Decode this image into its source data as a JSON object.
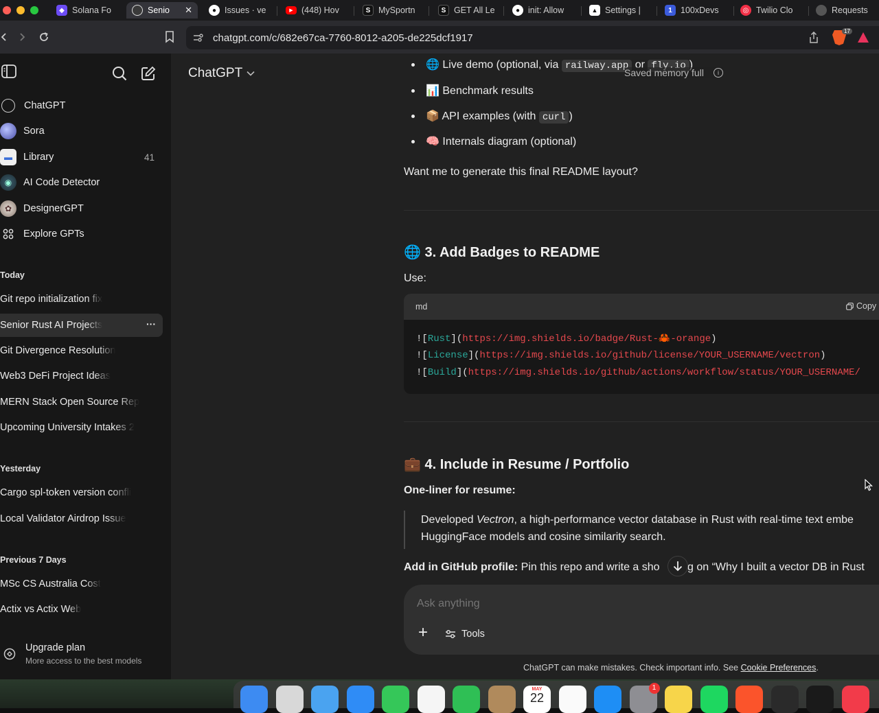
{
  "browser": {
    "tabs": [
      {
        "label": "Solana Fo",
        "icon": "solana-icon",
        "color": "#6c4cf5"
      },
      {
        "label": "Senio",
        "icon": "chatgpt-icon",
        "color": "#ffffff",
        "active": true,
        "close": "✕"
      },
      {
        "label": "Issues · ve",
        "icon": "github-icon",
        "color": "#ffffff"
      },
      {
        "label": "(448) Hov",
        "icon": "youtube-icon",
        "color": "#ff0000"
      },
      {
        "label": "MySportn",
        "icon": "s-icon",
        "color": "#111111"
      },
      {
        "label": "GET All Le",
        "icon": "s-icon",
        "color": "#111111"
      },
      {
        "label": "init: Allow",
        "icon": "github-icon",
        "color": "#ffffff"
      },
      {
        "label": "Settings |",
        "icon": "vercel-icon",
        "color": "#ffffff"
      },
      {
        "label": "100xDevs",
        "icon": "100xdevs-icon",
        "color": "#3b5bdb"
      },
      {
        "label": "Twilio Clo",
        "icon": "twilio-icon",
        "color": "#f22f46"
      },
      {
        "label": "Requests",
        "icon": "requests-icon",
        "color": "#555555"
      }
    ],
    "url": "chatgpt.com/c/682e67ca-7760-8012-a205-de225dcf1917",
    "shield_count": "17"
  },
  "sidebar": {
    "app_items": [
      {
        "label": "ChatGPT",
        "icon": "chatgpt-logo-icon"
      },
      {
        "label": "Sora",
        "icon": "sora-icon"
      },
      {
        "label": "Library",
        "icon": "library-icon",
        "count": "41"
      },
      {
        "label": "AI Code Detector",
        "icon": "gpt-avatar-icon"
      },
      {
        "label": "DesignerGPT",
        "icon": "gpt-avatar-icon"
      },
      {
        "label": "Explore GPTs",
        "icon": "grid-icon"
      }
    ],
    "sections": [
      {
        "title": "Today",
        "items": [
          "Git repo initialization fix",
          "Senior Rust AI Projects",
          "Git Divergence Resolution",
          "Web3 DeFi Project Ideas",
          "MERN Stack Open Source Rep",
          "Upcoming University Intakes 2"
        ]
      },
      {
        "title": "Yesterday",
        "items": [
          "Cargo spl-token version confli",
          "Local Validator Airdrop Issue"
        ]
      },
      {
        "title": "Previous 7 Days",
        "items": [
          "MSc CS Australia Cost",
          "Actix vs Actix Web"
        ]
      }
    ],
    "active_item": "Senior Rust AI Projects",
    "more_glyph": "···",
    "upgrade": {
      "title": "Upgrade plan",
      "subtitle": "More access to the best models"
    }
  },
  "header": {
    "model": "ChatGPT",
    "memory_notice": "Saved memory full"
  },
  "content": {
    "bullets": {
      "b1": {
        "emoji": "🌐",
        "pre": "Live demo (optional, via",
        "code1": "railway.app",
        "mid": "or",
        "code2": "fly.io",
        "post": ")"
      },
      "b2": {
        "emoji": "📊",
        "text": "Benchmark results"
      },
      "b3": {
        "emoji": "📦",
        "pre": "API examples (with",
        "code": "curl",
        "post": ")"
      },
      "b4": {
        "emoji": "🧠",
        "text": "Internals diagram (optional)"
      }
    },
    "question": "Want me to generate this final README layout?",
    "section3": {
      "emoji": "🌐",
      "title": "3. Add Badges to README",
      "use": "Use:"
    },
    "code": {
      "lang": "md",
      "copy": "Copy",
      "lines": [
        {
          "bang": "![",
          "label": "Rust",
          "mid": "](",
          "url": "https://img.shields.io/badge/Rust-🦀-orange",
          "end": ")"
        },
        {
          "bang": "![",
          "label": "License",
          "mid": "](",
          "url": "https://img.shields.io/github/license/YOUR_USERNAME/vectron",
          "end": ")"
        },
        {
          "bang": "![",
          "label": "Build",
          "mid": "](",
          "url": "https://img.shields.io/github/actions/workflow/status/YOUR_USERNAME/",
          "end": ""
        }
      ]
    },
    "section4": {
      "emoji": "💼",
      "title": "4. Include in Resume / Portfolio"
    },
    "oneliner_label": "One-liner for resume:",
    "quote": {
      "pre": "Developed ",
      "em": "Vectron",
      "post": ", a high-performance vector database in Rust with real-time text embe",
      "line2": "HuggingFace models and cosine similarity search."
    },
    "github": {
      "label": "Add in GitHub profile:",
      "text": "Pin this repo and write a sho",
      "text2": "log on “Why I built a vector DB in Rust"
    }
  },
  "composer": {
    "placeholder": "Ask anything",
    "plus": "+",
    "tools": "Tools"
  },
  "footer": {
    "text": "ChatGPT can make mistakes. Check important info. See ",
    "link": "Cookie Preferences",
    "end": "."
  },
  "dock": {
    "icons": [
      {
        "name": "finder-icon",
        "color": "#3d8bf2"
      },
      {
        "name": "launchpad-icon",
        "color": "#d8d8d8"
      },
      {
        "name": "maps-icon",
        "color": "#4aa3f0"
      },
      {
        "name": "safari-icon",
        "color": "#2f8cf6"
      },
      {
        "name": "messages-icon",
        "color": "#35c759"
      },
      {
        "name": "photos-icon",
        "color": "#f5f5f5"
      },
      {
        "name": "facetime-icon",
        "color": "#2fbf55"
      },
      {
        "name": "contacts-icon",
        "color": "#b08a5c"
      },
      {
        "name": "calendar-icon",
        "color": "#ffffff",
        "month": "MAY",
        "day": "22"
      },
      {
        "name": "reminders-icon",
        "color": "#fafafa"
      },
      {
        "name": "app-store-icon",
        "color": "#1e8ef5"
      },
      {
        "name": "system-settings-icon",
        "color": "#8e8e93",
        "badge": "1"
      },
      {
        "name": "notes-icon",
        "color": "#f7d54a"
      },
      {
        "name": "spotify-icon",
        "color": "#1ed760"
      },
      {
        "name": "brave-icon",
        "color": "#fb542b"
      },
      {
        "name": "vercel-app-icon",
        "color": "#2a2a2a"
      },
      {
        "name": "terminal-icon",
        "color": "#1a1a1a"
      },
      {
        "name": "news-icon",
        "color": "#f23b4a"
      }
    ]
  }
}
